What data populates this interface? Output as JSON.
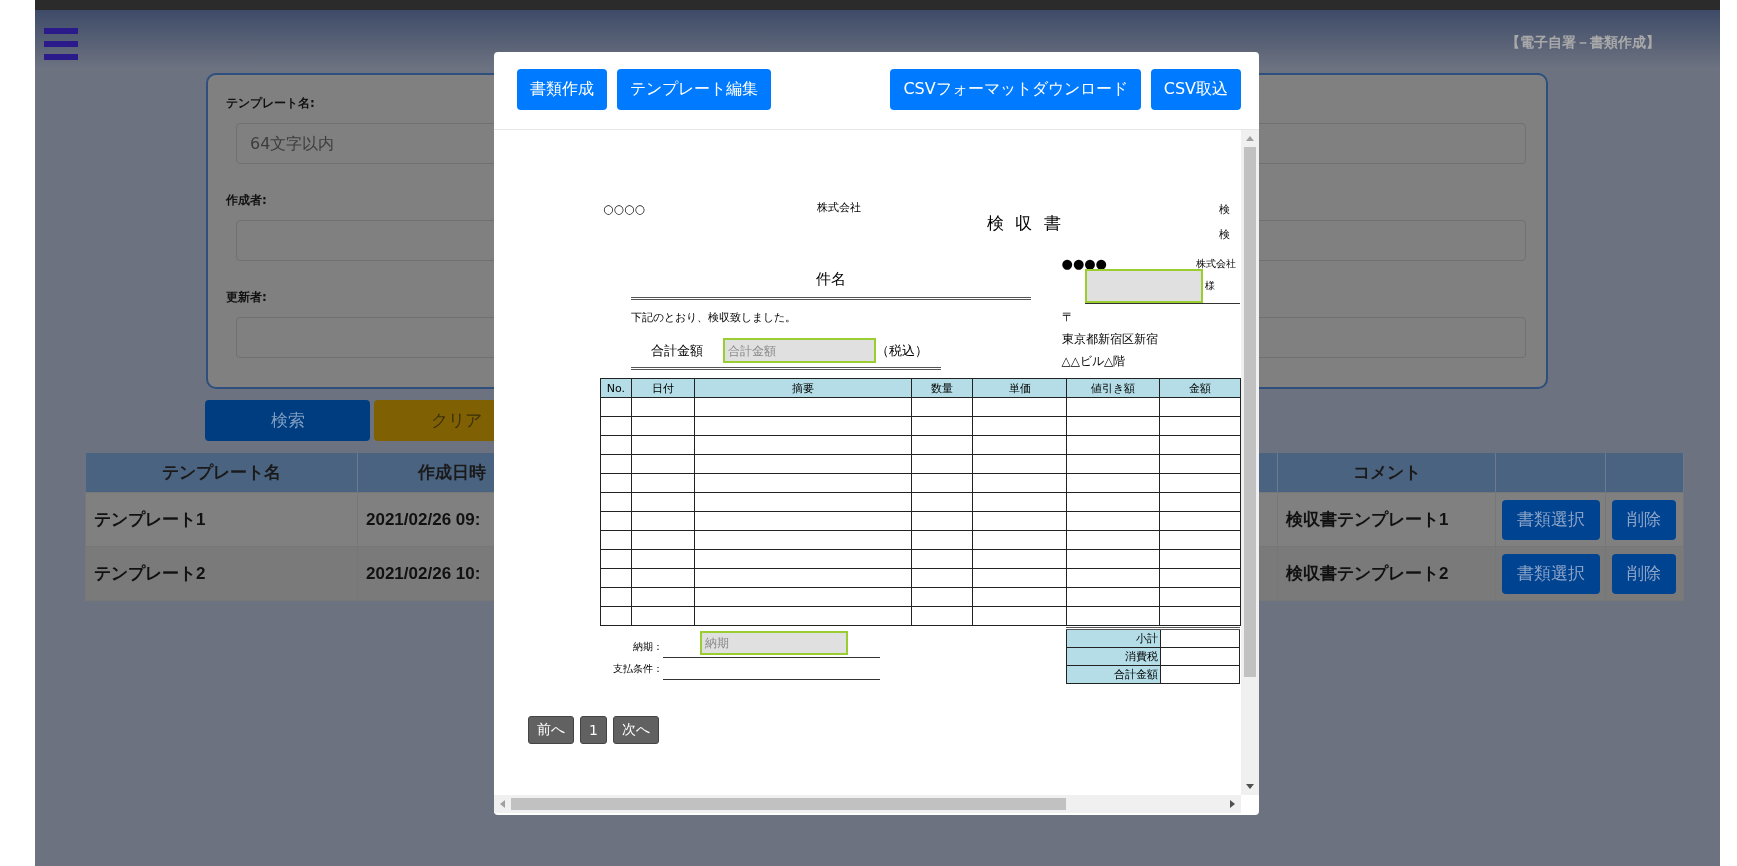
{
  "header": {
    "title": "【電子自署－書類作成】"
  },
  "search_form": {
    "fields": [
      {
        "label": "テンプレート名:",
        "placeholder": "64文字以内"
      },
      {
        "label": "作成者:"
      },
      {
        "label": "更新者:"
      }
    ]
  },
  "search_buttons": [
    {
      "label": "検索",
      "kind": "primary"
    },
    {
      "label": "クリア",
      "kind": "warning"
    }
  ],
  "templates_table": {
    "columns_left": [
      "テンプレート名",
      "作成日時"
    ],
    "columns_right": [
      "コメント"
    ],
    "rows": [
      {
        "name": "テンプレート1",
        "created": "2021/02/26 09:",
        "comment": "検収書テンプレート1",
        "select": "書類選択",
        "delete": "削除"
      },
      {
        "name": "テンプレート2",
        "created": "2021/02/26 10:",
        "comment": "検収書テンプレート2",
        "select": "書類選択",
        "delete": "削除"
      }
    ]
  },
  "modal": {
    "buttons_left": [
      "書類作成",
      "テンプレート編集"
    ],
    "buttons_right": [
      "CSVフォーマットダウンロード",
      "CSV取込"
    ],
    "document": {
      "sender": "○○○○",
      "sender_company": "株式会社",
      "title": "検 収 書",
      "corner_labels": [
        "検",
        "検"
      ],
      "subject": "件名",
      "intro": "下記のとおり、検収致しました。",
      "total_label": "合計金額",
      "total_placeholder": "合計金額",
      "tax_note": "（税込）",
      "recipient": "●●●●",
      "recipient_company": "株式会社",
      "honorific": "様",
      "postal_mark": "〒",
      "address_lines": [
        "東京都新宿区新宿",
        "△△ビル△階"
      ],
      "columns": [
        "No.",
        "日付",
        "摘要",
        "数量",
        "単価",
        "値引き額",
        "金額"
      ],
      "summary_rows": [
        "小計",
        "消費税",
        "合計金額"
      ],
      "delivery_label": "納期：",
      "delivery_placeholder": "納期",
      "payment_label": "支払条件："
    },
    "pagination": {
      "prev": "前へ",
      "page": "1",
      "next": "次へ"
    }
  }
}
